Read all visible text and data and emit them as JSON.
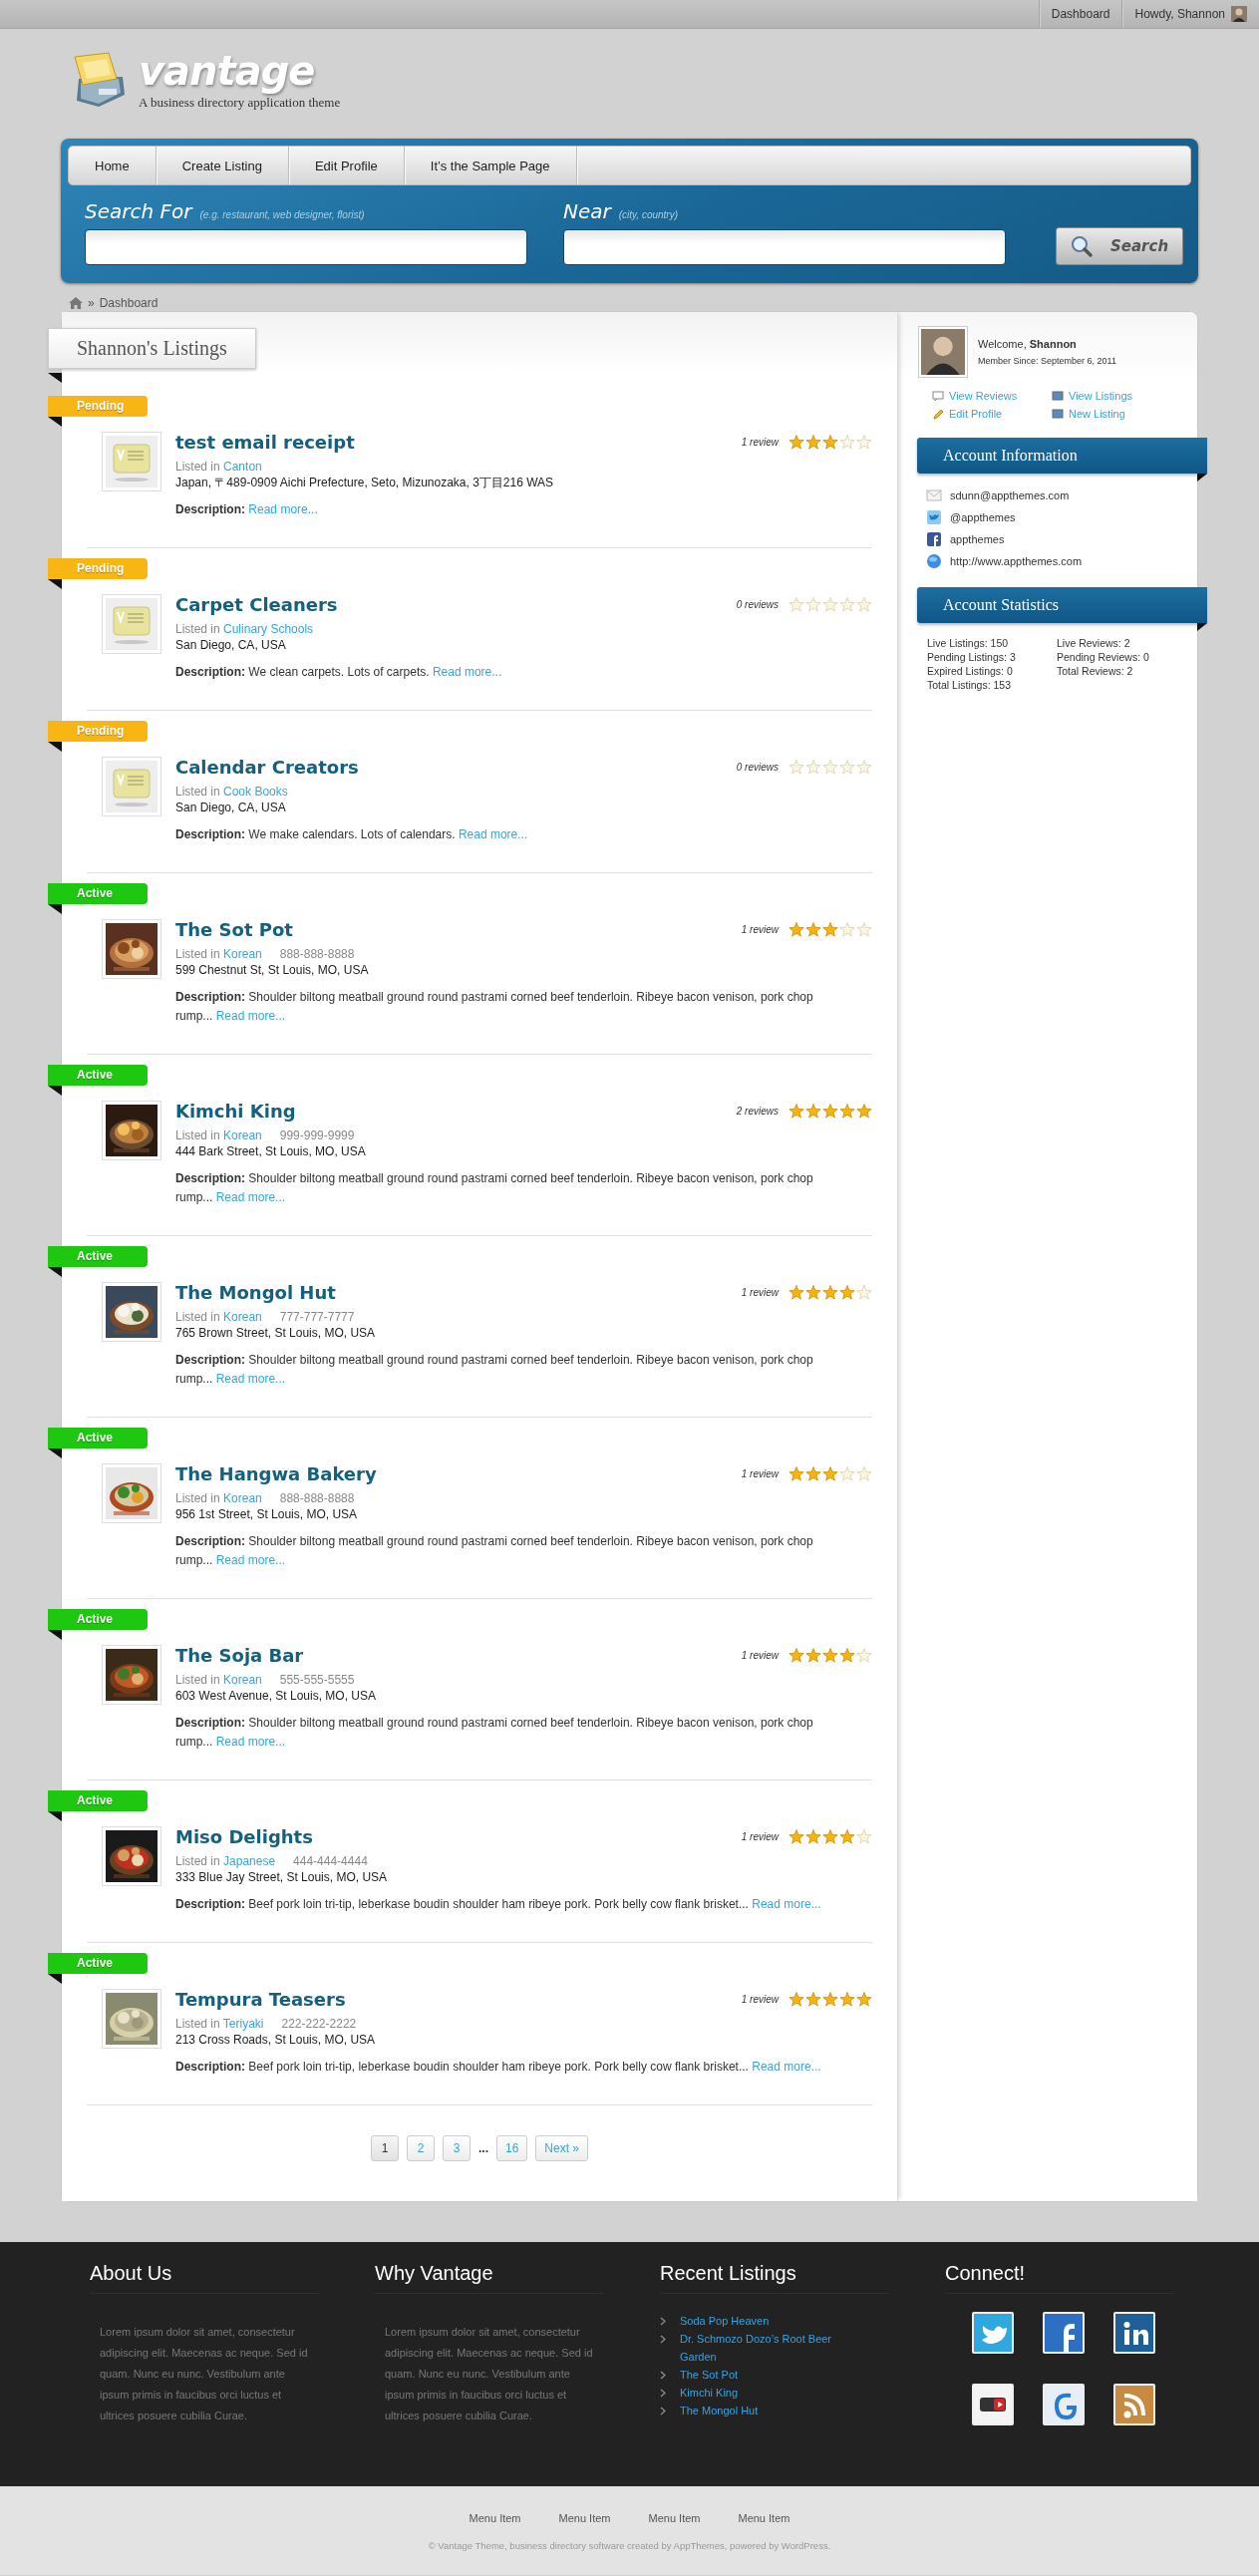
{
  "admin_bar": {
    "items": [
      {
        "label": "Dashboard"
      },
      {
        "label": "Howdy, Shannon"
      }
    ]
  },
  "site": {
    "name": "vantage",
    "tagline": "A business directory application theme"
  },
  "nav": {
    "items": [
      {
        "label": "Home"
      },
      {
        "label": "Create Listing"
      },
      {
        "label": "Edit Profile"
      },
      {
        "label": "It’s the Sample Page"
      }
    ]
  },
  "search": {
    "what_label": "Search For",
    "what_hint": "(e.g. restaurant, web designer, florist)",
    "where_label": "Near",
    "where_hint": "(city, country)",
    "button": "Search"
  },
  "breadcrumb": {
    "separator": "»",
    "current": "Dashboard"
  },
  "listings_title": "Shannon's Listings",
  "listings": [
    {
      "status": {
        "label": "Pending",
        "color": "#f7b614"
      },
      "photo": false,
      "title": "test email receipt",
      "listed_label": "Listed in",
      "category": "Canton",
      "address": "Japan, 〒489-0909 Aichi Prefecture, Seto, Mizunozaka, 3丁目216 WAS",
      "reviews": "1 review",
      "stars": 3,
      "description": "**Description:**",
      "read_more": "Read more..."
    },
    {
      "status": {
        "label": "Pending",
        "color": "#f7b614"
      },
      "photo": false,
      "title": "Carpet Cleaners",
      "listed_label": "Listed in",
      "category": "Culinary Schools",
      "address": "San Diego, CA, USA",
      "reviews": "0 reviews",
      "stars": 0,
      "description": "**Description:** We clean carpets. Lots of carpets.",
      "read_more": "Read more..."
    },
    {
      "status": {
        "label": "Pending",
        "color": "#f7b614"
      },
      "photo": false,
      "title": "Calendar Creators",
      "listed_label": "Listed in",
      "category": "Cook Books",
      "address": "San Diego, CA, USA",
      "reviews": "0 reviews",
      "stars": 0,
      "description": "**Description:** We make calendars. Lots of calendars.",
      "read_more": "Read more..."
    },
    {
      "status": {
        "label": "Active",
        "color": "#1ec810"
      },
      "photo": true,
      "title": "The Sot Pot",
      "listed_label": "Listed in",
      "category": "Korean",
      "phone": "888-888-8888",
      "address": "599 Chestnut St, St Louis, MO, USA",
      "reviews": "1 review",
      "stars": 3,
      "description": "**Description:** Shoulder biltong meatball ground round pastrami corned beef tenderloin. Ribeye bacon venison, pork chop rump...",
      "read_more": "Read more..."
    },
    {
      "status": {
        "label": "Active",
        "color": "#1ec810"
      },
      "photo": true,
      "title": "Kimchi King",
      "listed_label": "Listed in",
      "category": "Korean",
      "phone": "999-999-9999",
      "address": "444 Bark Street, St Louis, MO, USA",
      "reviews": "2 reviews",
      "stars": 5,
      "description": "**Description:** Shoulder biltong meatball ground round pastrami corned beef tenderloin. Ribeye bacon venison, pork chop rump...",
      "read_more": "Read more..."
    },
    {
      "status": {
        "label": "Active",
        "color": "#1ec810"
      },
      "photo": true,
      "title": "The Mongol Hut",
      "listed_label": "Listed in",
      "category": "Korean",
      "phone": "777-777-7777",
      "address": "765 Brown Street, St Louis, MO, USA",
      "reviews": "1 review",
      "stars": 4,
      "description": "**Description:** Shoulder biltong meatball ground round pastrami corned beef tenderloin. Ribeye bacon venison, pork chop rump...",
      "read_more": "Read more..."
    },
    {
      "status": {
        "label": "Active",
        "color": "#1ec810"
      },
      "photo": true,
      "title": "The Hangwa Bakery",
      "listed_label": "Listed in",
      "category": "Korean",
      "phone": "888-888-8888",
      "address": "956 1st Street, St Louis, MO, USA",
      "reviews": "1 review",
      "stars": 3,
      "description": "**Description:** Shoulder biltong meatball ground round pastrami corned beef tenderloin. Ribeye bacon venison, pork chop rump...",
      "read_more": "Read more..."
    },
    {
      "status": {
        "label": "Active",
        "color": "#1ec810"
      },
      "photo": true,
      "title": "The Soja Bar",
      "listed_label": "Listed in",
      "category": "Korean",
      "phone": "555-555-5555",
      "address": "603 West Avenue, St Louis, MO, USA",
      "reviews": "1 review",
      "stars": 4,
      "description": "**Description:** Shoulder biltong meatball ground round pastrami corned beef tenderloin. Ribeye bacon venison, pork chop rump...",
      "read_more": "Read more..."
    },
    {
      "status": {
        "label": "Active",
        "color": "#1ec810"
      },
      "photo": true,
      "title": "Miso Delights",
      "listed_label": "Listed in",
      "category": "Japanese",
      "phone": "444-444-4444",
      "address": "333 Blue Jay Street, St Louis, MO, USA",
      "reviews": "1 review",
      "stars": 4,
      "description": "**Description:** Beef pork loin tri-tip, leberkase boudin shoulder ham ribeye pork. Pork belly cow flank brisket...",
      "read_more": "Read more..."
    },
    {
      "status": {
        "label": "Active",
        "color": "#1ec810"
      },
      "photo": true,
      "title": "Tempura Teasers",
      "listed_label": "Listed in",
      "category": "Teriyaki",
      "phone": "222-222-2222",
      "address": "213 Cross Roads, St Louis, MO, USA",
      "reviews": "1 review",
      "stars": 5,
      "description": "**Description:** Beef pork loin tri-tip, leberkase boudin shoulder ham ribeye pork. Pork belly cow flank brisket...",
      "read_more": "Read more..."
    }
  ],
  "pagination": [
    {
      "label": "1",
      "kind": "page",
      "selected": true
    },
    {
      "label": "2",
      "kind": "page",
      "selected": false
    },
    {
      "label": "3",
      "kind": "page",
      "selected": false
    },
    {
      "label": "...",
      "kind": "ellipsis",
      "selected": false
    },
    {
      "label": "16",
      "kind": "page",
      "selected": false
    },
    {
      "label": "Next »",
      "kind": "next",
      "selected": false
    }
  ],
  "sidebar": {
    "welcome": "Welcome, **Shannon**",
    "member_since": "Member Since: September 6, 2011",
    "links": [
      {
        "label": "View Reviews"
      },
      {
        "label": "View Listings"
      },
      {
        "label": "Edit Profile"
      },
      {
        "label": "New Listing"
      }
    ],
    "account_info": {
      "title": "Account Information",
      "items": [
        {
          "text": "sdunn@appthemes.com"
        },
        {
          "text": "@appthemes"
        },
        {
          "text": "appthemes"
        },
        {
          "text": "http://www.appthemes.com"
        }
      ]
    },
    "account_stats": {
      "title": "Account Statistics",
      "items": [
        "Live Listings: 150",
        "Pending Listings: 3",
        "Expired Listings: 0",
        "Total Listings: 153",
        "Live Reviews: 2",
        "Pending Reviews: 0",
        "Total Reviews: 2"
      ]
    }
  },
  "footer": {
    "columns": [
      {
        "kind": "text",
        "title": "About Us",
        "text": "Lorem ipsum dolor sit amet, consectetur adipiscing elit. Maecenas ac neque. Sed id quam. Nunc eu nunc. Vestibulum ante ipsum primis in faucibus orci luctus et ultrices posuere cubilia Curae."
      },
      {
        "kind": "text",
        "title": "Why Vantage",
        "text": "Lorem ipsum dolor sit amet, consectetur adipiscing elit. Maecenas ac neque. Sed id quam. Nunc eu nunc. Vestibulum ante ipsum primis in faucibus orci luctus et ultrices posuere cubilia Curae."
      },
      {
        "kind": "links",
        "title": "Recent Listings",
        "links": [
          "Soda Pop Heaven",
          "Dr. Schmozo Dozo’s Root Beer Garden",
          "The Sot Pot",
          "Kimchi King",
          "The Mongol Hut"
        ]
      },
      {
        "kind": "social",
        "title": "Connect!"
      }
    ],
    "menu": [
      "Menu Item",
      "Menu Item",
      "Menu Item",
      "Menu Item"
    ],
    "copyright": "© Vantage Theme, business directory software created by AppThemes, powered by WordPress."
  }
}
